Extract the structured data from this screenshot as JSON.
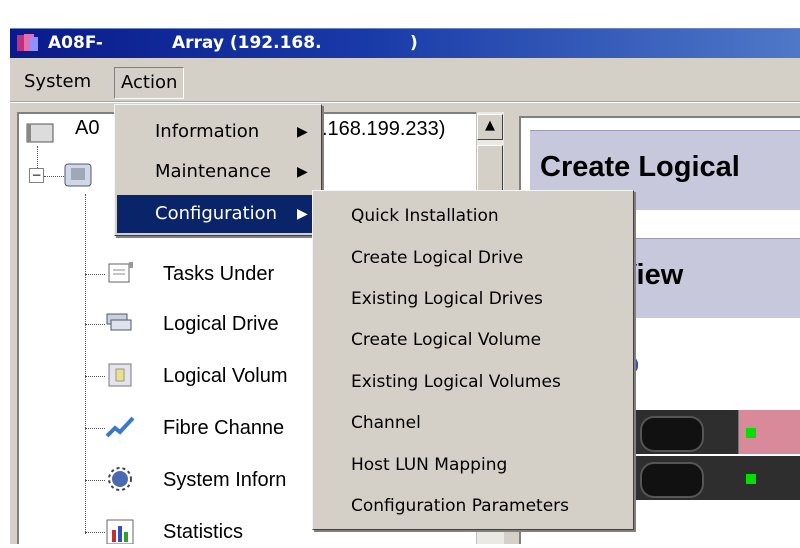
{
  "window": {
    "title_left": "A08F-",
    "title_right": "Array (192.168.",
    "title_paren": ")"
  },
  "menubar": {
    "items": [
      "System",
      "Action"
    ]
  },
  "action_menu": {
    "items": [
      {
        "label": "Information",
        "arrow": "▶"
      },
      {
        "label": "Maintenance",
        "arrow": "▶"
      },
      {
        "label": "Configuration",
        "arrow": "▶"
      }
    ]
  },
  "config_submenu": {
    "items": [
      "Quick Installation",
      "Create Logical Drive",
      "Existing Logical Drives",
      "Create Logical Volume",
      "Existing Logical Volumes",
      "Channel",
      "Host LUN Mapping",
      "Configuration Parameters"
    ]
  },
  "tree": {
    "root_label_visible": "A0",
    "root_ip_visible": ".168.199.233)",
    "expander": "−",
    "items": [
      {
        "label": "Tasks Under",
        "icon": "tasks-icon"
      },
      {
        "label": "Logical Drive",
        "icon": "logical-drive-icon"
      },
      {
        "label": "Logical Volum",
        "icon": "logical-volume-icon"
      },
      {
        "label": "Fibre Channe",
        "icon": "fibre-channel-icon"
      },
      {
        "label": "System Inforn",
        "icon": "system-info-icon"
      },
      {
        "label": "Statistics",
        "icon": "statistics-icon"
      }
    ]
  },
  "right_panel": {
    "banner1": "Create Logical",
    "banner2": "t View"
  },
  "scrollbar": {
    "up_arrow": "▲"
  },
  "colors": {
    "title_bar": "#0a1a8a",
    "menu_highlight": "#0a246a",
    "menu_bg": "#d4d0c8",
    "banner_bg": "#c8c8dc",
    "drive_led": "#00e000"
  }
}
